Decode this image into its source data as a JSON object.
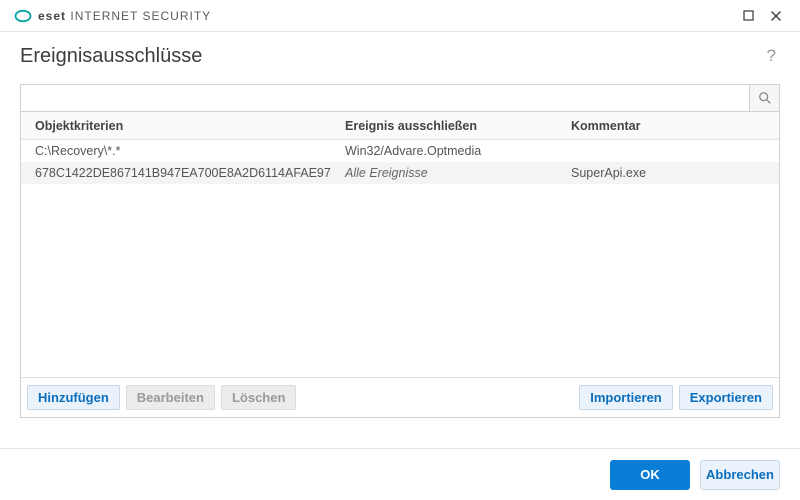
{
  "titlebar": {
    "brand_bold": "eset",
    "product": "INTERNET SECURITY"
  },
  "header": {
    "title": "Ereignisausschlüsse"
  },
  "search": {
    "value": ""
  },
  "table": {
    "columns": {
      "object": "Objektkriterien",
      "exclude": "Ereignis ausschließen",
      "comment": "Kommentar"
    },
    "rows": [
      {
        "object": "C:\\Recovery\\*.*",
        "exclude": "Win32/Advare.Optmedia",
        "comment": "",
        "italic": false
      },
      {
        "object": "678C1422DE867141B947EA700E8A2D6114AFAE97",
        "exclude": "Alle Ereignisse",
        "comment": "SuperApi.exe",
        "italic": true
      }
    ],
    "buttons": {
      "add": "Hinzufügen",
      "edit": "Bearbeiten",
      "delete": "Löschen",
      "import": "Importieren",
      "export": "Exportieren"
    }
  },
  "footer": {
    "ok": "OK",
    "cancel": "Abbrechen"
  }
}
